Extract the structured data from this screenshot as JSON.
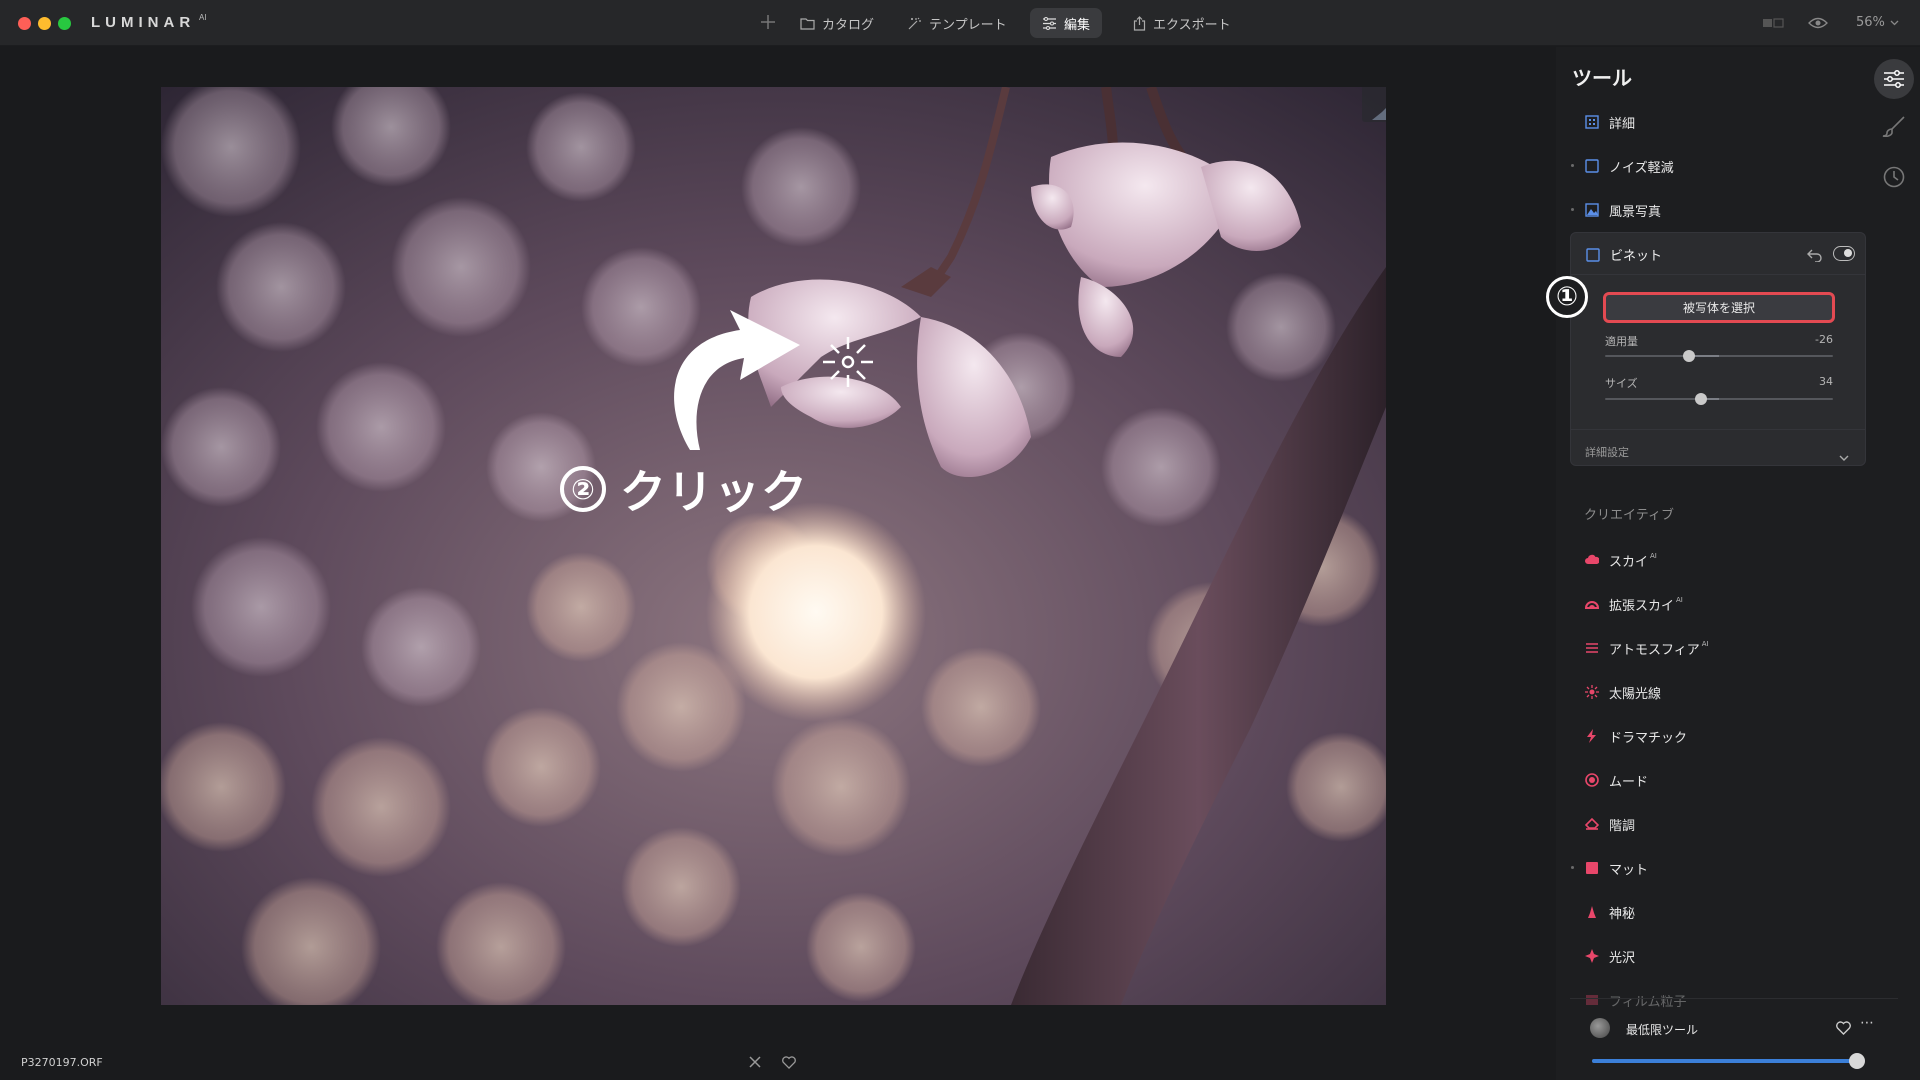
{
  "window": {
    "app_name": "LUMINAR",
    "app_suffix": "AI"
  },
  "nav": {
    "catalog": "カタログ",
    "template": "テンプレート",
    "edit": "編集",
    "export": "エクスポート"
  },
  "view": {
    "zoom": "56%"
  },
  "file": {
    "name": "P3270197.ORF"
  },
  "annotations": {
    "step1": "①",
    "step2_num": "②",
    "step2_text": "クリック"
  },
  "panel": {
    "title": "ツール",
    "tools": [
      {
        "label": "詳細",
        "icon": "detail-icon"
      },
      {
        "label": "ノイズ軽減",
        "icon": "noise-icon"
      },
      {
        "label": "風景写真",
        "icon": "landscape-icon"
      }
    ],
    "vignette": {
      "title": "ビネット",
      "select_subject": "被写体を選択",
      "amount_label": "適用量",
      "amount_value": "-26",
      "amount_level": -0.26,
      "size_label": "サイズ",
      "size_value": "34",
      "size_level": 0.34,
      "advanced": "詳細設定"
    },
    "creative_title": "クリエイティブ",
    "creative": [
      {
        "label": "スカイ",
        "ai": "AI",
        "icon": "sky-icon",
        "color": "#e8476a"
      },
      {
        "label": "拡張スカイ",
        "ai": "AI",
        "icon": "augmented-sky-icon",
        "color": "#e8476a"
      },
      {
        "label": "アトモスフィア",
        "ai": "AI",
        "icon": "atmosphere-icon",
        "color": "#e8476a"
      },
      {
        "label": "太陽光線",
        "icon": "sunrays-icon",
        "color": "#e8476a"
      },
      {
        "label": "ドラマチック",
        "icon": "dramatic-icon",
        "color": "#e8476a"
      },
      {
        "label": "ムード",
        "icon": "mood-icon",
        "color": "#e8476a"
      },
      {
        "label": "階調",
        "icon": "toning-icon",
        "color": "#e8476a"
      },
      {
        "label": "マット",
        "icon": "matte-icon",
        "color": "#e8476a"
      },
      {
        "label": "神秘",
        "icon": "mystical-icon",
        "color": "#e8476a"
      },
      {
        "label": "光沢",
        "icon": "glow-icon",
        "color": "#e8476a"
      },
      {
        "label": "フィルム粒子",
        "icon": "film-grain-icon",
        "color": "#e8476a"
      }
    ],
    "preset": {
      "name": "最低限ツール",
      "more": "⋯",
      "level": 0.98
    }
  },
  "colors": {
    "accent_red": "#e34a52",
    "accent_blue": "#3b7fd8",
    "creative_icon": "#e8476a",
    "tool_icon": "#5b8fe8"
  }
}
